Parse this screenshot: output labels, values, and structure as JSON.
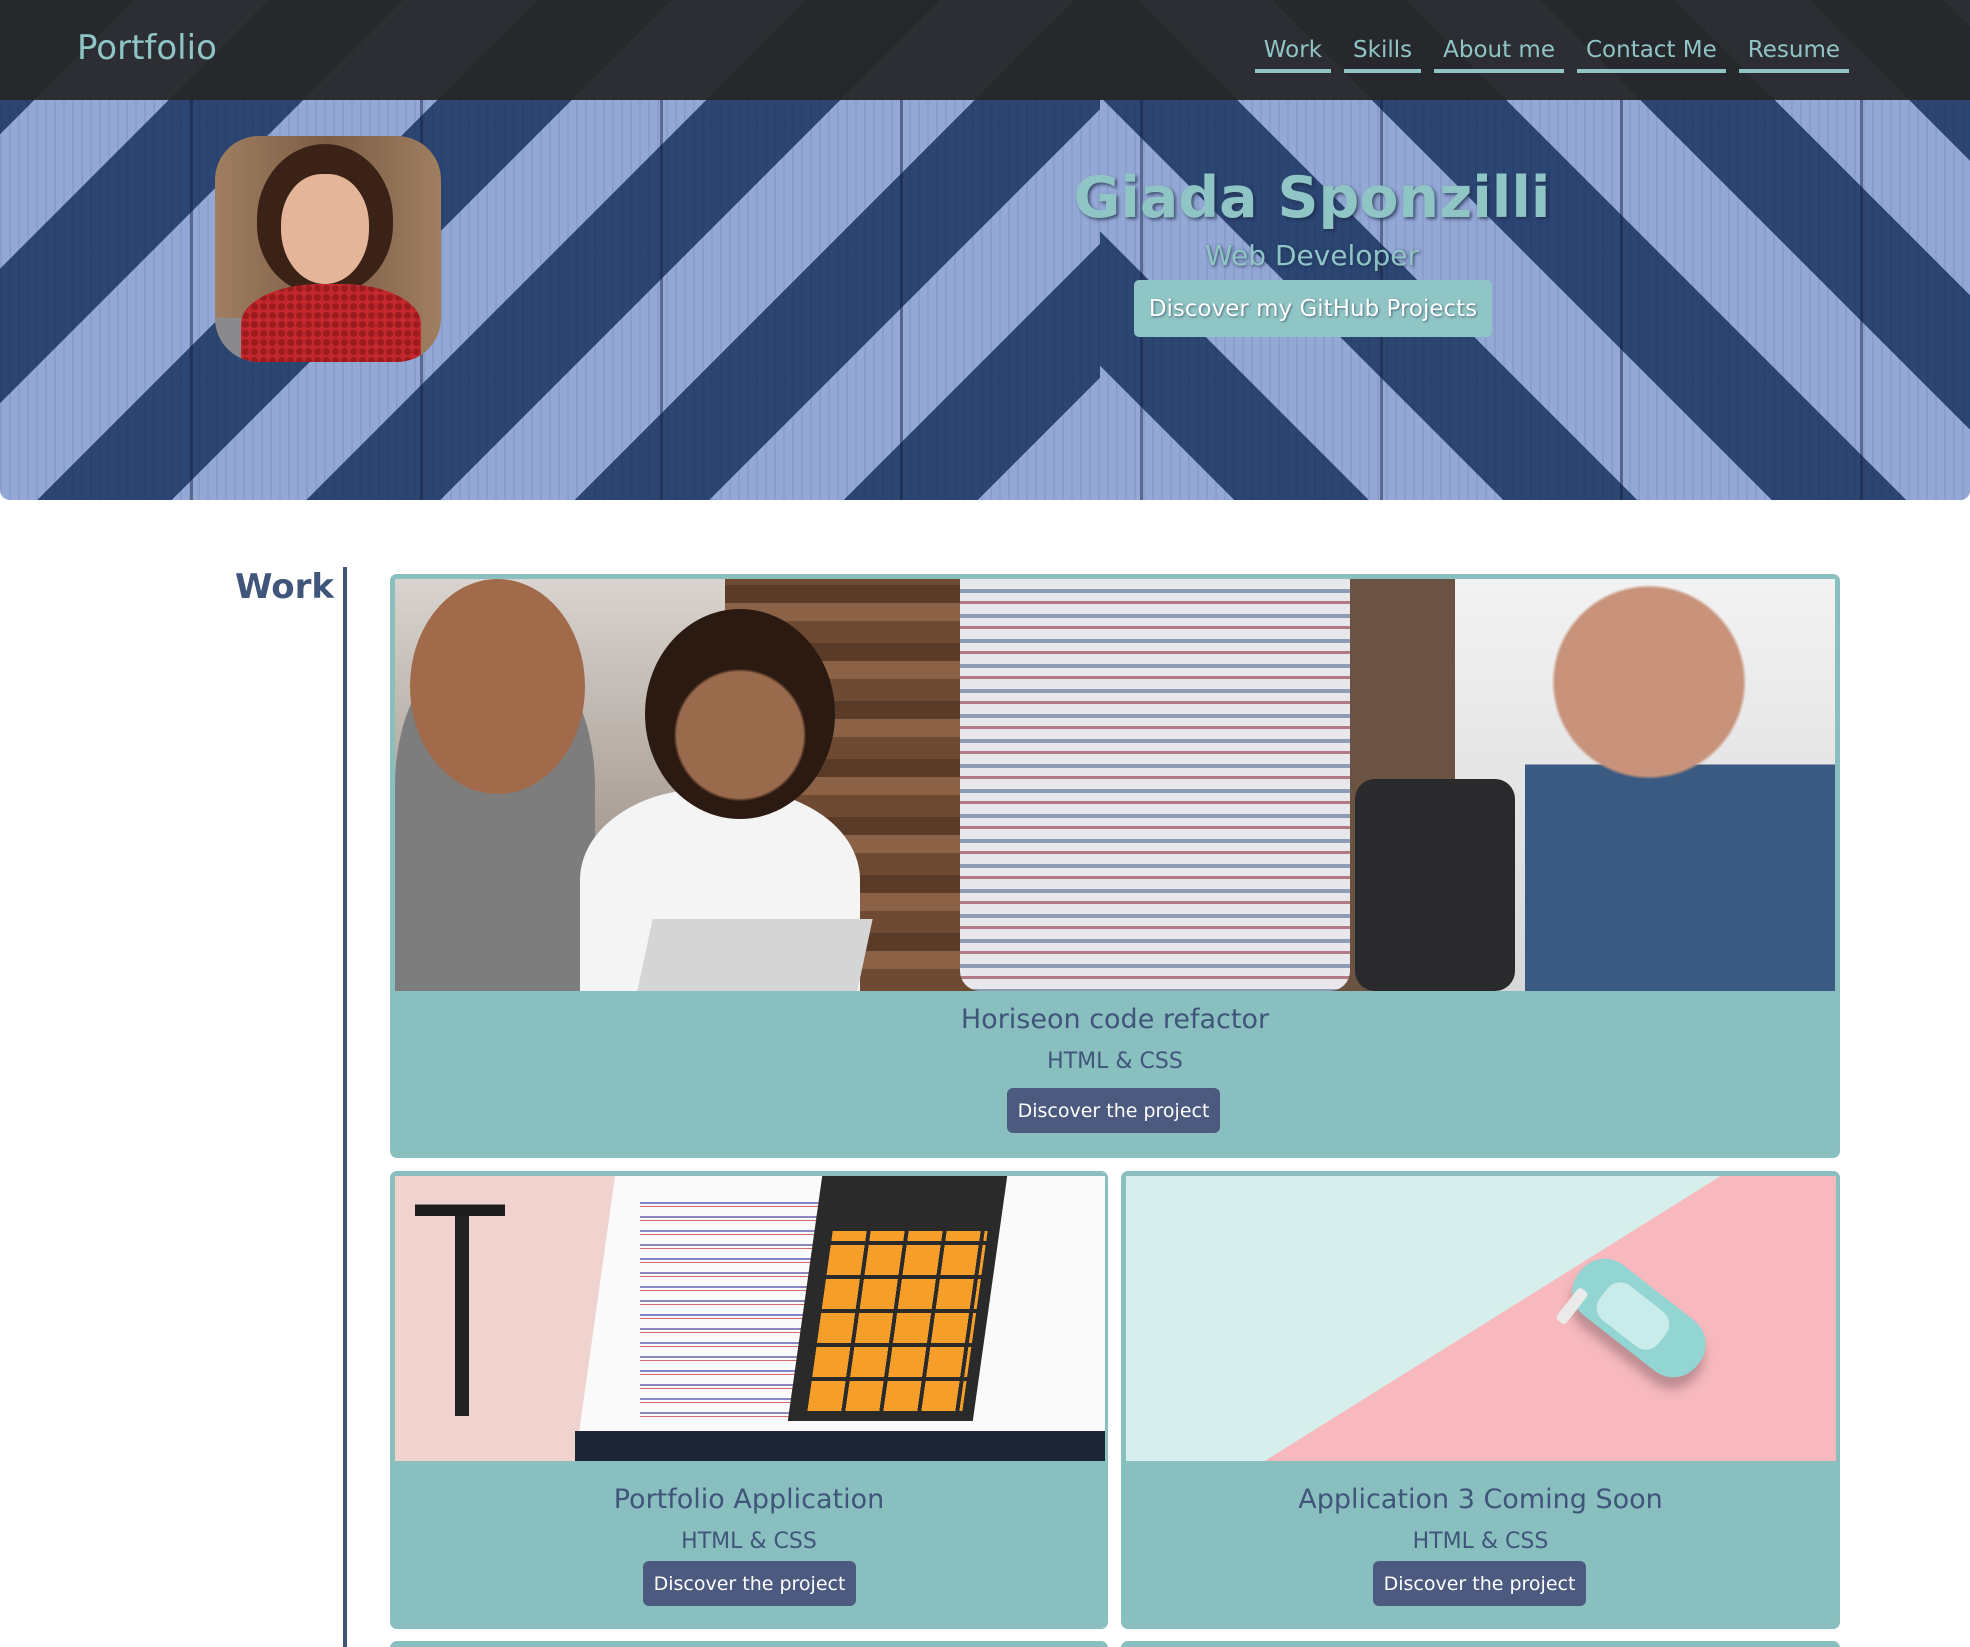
{
  "nav": {
    "brand": "Portfolio",
    "links": [
      "Work",
      "Skills",
      "About me",
      "Contact Me",
      "Resume"
    ]
  },
  "hero": {
    "name": "Giada Sponzilli",
    "role": "Web Developer",
    "cta_label": "Discover my GitHub Projects"
  },
  "work": {
    "title": "Work",
    "projects": [
      {
        "title": "Horiseon code refactor",
        "tech": "HTML & CSS",
        "button_label": "Discover the project"
      },
      {
        "title": "Portfolio Application",
        "tech": "HTML & CSS",
        "button_label": "Discover the project"
      },
      {
        "title": "Application 3 Coming Soon",
        "tech": "HTML & CSS",
        "button_label": "Discover the project"
      }
    ]
  },
  "colors": {
    "accent_teal": "#8fc5c5",
    "card_teal": "#8abfc0",
    "navy": "#3f5579",
    "button_navy": "#4b5a7e",
    "navbar": "#262628"
  }
}
